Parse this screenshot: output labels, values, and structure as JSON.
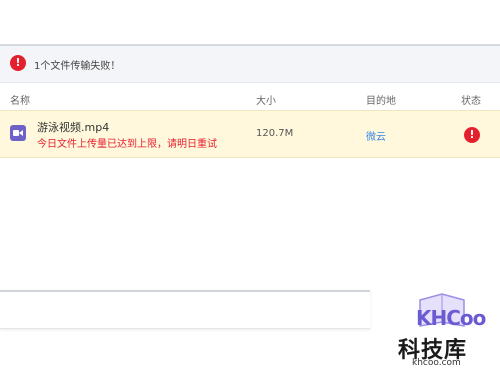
{
  "alert": {
    "message": "1个文件传输失败！",
    "icon": "error-icon",
    "color": "#e5202e"
  },
  "table": {
    "columns": [
      "名称",
      "大小",
      "目的地",
      "状态"
    ],
    "rows": [
      {
        "name": "游泳视频.mp4",
        "error": "今日文件上传量已达到上限，请明日重试",
        "size": "120.7M",
        "destination": "微云",
        "status_icon": "error-icon",
        "file_icon": "video-icon"
      }
    ]
  },
  "watermark": {
    "logo": "KHCoo",
    "title": "科技库",
    "url": "khcoo.com"
  },
  "colors": {
    "error": "#e5202e",
    "link": "#3a86e6",
    "highlight_row": "#fff8dc",
    "file_icon": "#6c63c9"
  }
}
